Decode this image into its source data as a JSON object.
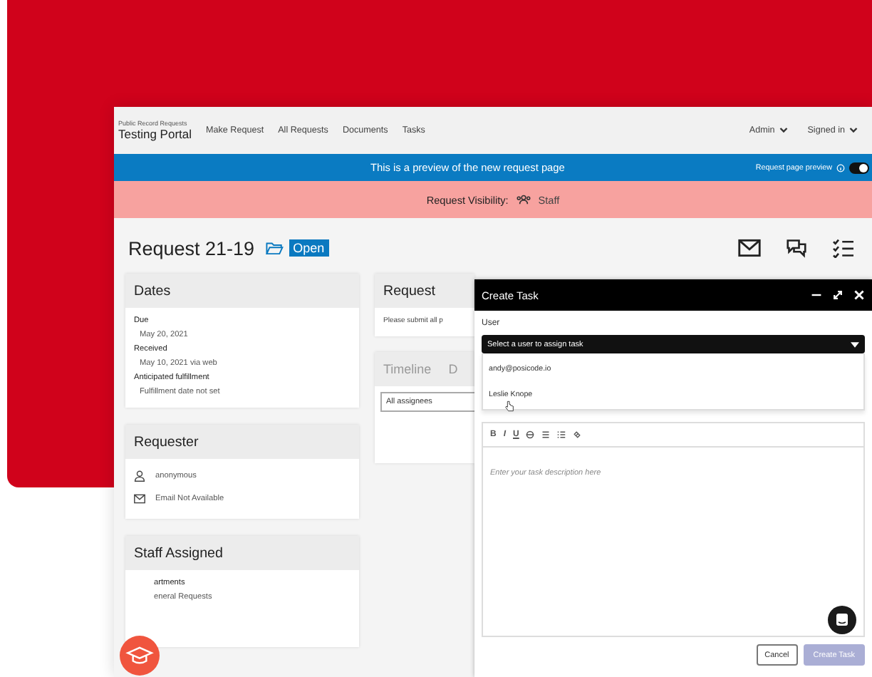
{
  "brand": {
    "subtitle": "Public Record Requests",
    "title": "Testing Portal"
  },
  "nav": [
    "Make Request",
    "All Requests",
    "Documents",
    "Tasks"
  ],
  "nav_menus": [
    "Admin",
    "Signed in"
  ],
  "preview_banner": {
    "text": "This is a preview of the new request page",
    "toggle_label": "Request page preview",
    "on": true
  },
  "visibility": {
    "label": "Request Visibility:",
    "value": "Staff"
  },
  "request": {
    "title": "Request 21-19",
    "status": "Open"
  },
  "dates": {
    "title": "Dates",
    "fields": [
      {
        "label": "Due",
        "value": "May 20, 2021"
      },
      {
        "label": "Received",
        "value": "May 10, 2021 via web"
      },
      {
        "label": "Anticipated fulfillment",
        "value": "Fulfillment date not set"
      }
    ]
  },
  "requester": {
    "title": "Requester",
    "name": "anonymous",
    "email": "Email Not Available"
  },
  "staff": {
    "title": "Staff Assigned",
    "label": "artments",
    "value": "eneral Requests"
  },
  "request_card": {
    "title": "Request",
    "text": "Please submit all p"
  },
  "timeline": {
    "tabs": [
      "Timeline",
      "D"
    ],
    "filter": "All assignees"
  },
  "modal": {
    "title": "Create Task",
    "user_label": "User",
    "select_placeholder": "Select a user to assign task",
    "options": [
      "andy@posicode.io",
      "Leslie Knope"
    ],
    "toolbar": [
      "B",
      "I",
      "U"
    ],
    "editor_placeholder": "Enter your task description here",
    "buttons": [
      {
        "label": "Cancel",
        "kind": "secondary"
      },
      {
        "label": "Create Task",
        "kind": "primary"
      }
    ]
  }
}
